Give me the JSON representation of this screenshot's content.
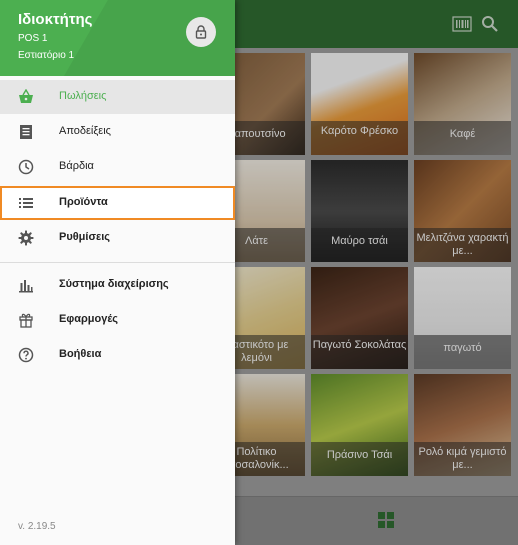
{
  "drawer": {
    "owner": "Ιδιοκτήτης",
    "pos": "POS 1",
    "restaurant": "Εστιατόριο 1",
    "items": [
      {
        "label": "Πωλήσεις",
        "icon": "basket-icon"
      },
      {
        "label": "Αποδείξεις",
        "icon": "receipt-icon"
      },
      {
        "label": "Βάρδια",
        "icon": "clock-icon"
      },
      {
        "label": "Προϊόντα",
        "icon": "list-icon"
      },
      {
        "label": "Ρυθμίσεις",
        "icon": "gear-icon"
      },
      {
        "label": "Σύστημα διαχείρισης",
        "icon": "bar-chart-icon"
      },
      {
        "label": "Εφαρμογές",
        "icon": "apps-gift-icon"
      },
      {
        "label": "Βοήθεια",
        "icon": "help-icon"
      }
    ],
    "version": "v. 2.19.5"
  },
  "products": [
    {
      "name": "Καπουτσίνο"
    },
    {
      "name": "Καρότο Φρέσκο"
    },
    {
      "name": "Καφέ"
    },
    {
      "name": "Λάτε"
    },
    {
      "name": "Μαύρο τσάι"
    },
    {
      "name": "Μελιτζάνα χαρακτή με..."
    },
    {
      "name": "Παστικότο με λεμόνι"
    },
    {
      "name": "Παγωτό Σοκολάτας"
    },
    {
      "name": "παγωτό"
    },
    {
      "name": "Πολίτικο τσοσαλονίκ..."
    },
    {
      "name": "Πράσινο Τσάι"
    },
    {
      "name": "Ρολό κιμά γεμιστό με..."
    }
  ],
  "colors": {
    "accent": "#4caf50",
    "app_bar": "#2f6b31",
    "highlight_border": "#f08a24"
  }
}
